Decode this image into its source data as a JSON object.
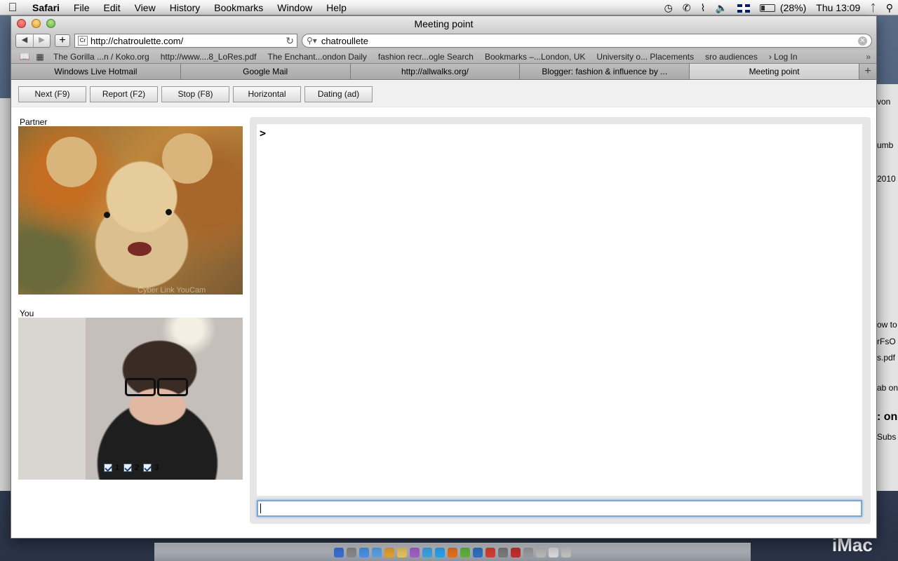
{
  "menubar": {
    "apple": "",
    "items": [
      "Safari",
      "File",
      "Edit",
      "View",
      "History",
      "Bookmarks",
      "Window",
      "Help"
    ],
    "battery": "(28%)",
    "clock": "Thu 13:09"
  },
  "window": {
    "title": "Meeting point"
  },
  "toolbar": {
    "url": "http://chatroulette.com/",
    "favicon_text": "Cr",
    "search_value": "chatroullete"
  },
  "bookmarks": [
    "The Gorilla ...n / Koko.org",
    "http://www....8_LoRes.pdf",
    "The Enchant...ondon Daily",
    "fashion recr...ogle Search",
    "Bookmarks –...London, UK",
    "University o... Placements",
    "sro audiences",
    "› Log In"
  ],
  "tabs": [
    {
      "label": "Windows Live Hotmail",
      "active": false
    },
    {
      "label": "Google Mail",
      "active": false
    },
    {
      "label": "http://allwalks.org/",
      "active": false
    },
    {
      "label": "Blogger: fashion & influence by ...",
      "active": false
    },
    {
      "label": "Meeting point",
      "active": true
    }
  ],
  "controls": {
    "next": "Next (F9)",
    "report": "Report (F2)",
    "stop": "Stop (F8)",
    "horizontal": "Horizontal",
    "dating": "Dating (ad)"
  },
  "videos": {
    "partner_label": "Partner",
    "you_label": "You",
    "watermark": "Cyber Link YouCam"
  },
  "checkboxes": [
    {
      "label": "1",
      "checked": true
    },
    {
      "label": "2",
      "checked": true
    },
    {
      "label": "3",
      "checked": true
    }
  ],
  "chat": {
    "prompt": ">",
    "input_value": ""
  },
  "desktop": {
    "imac_text": "iMac",
    "right_fragments": [
      "von",
      "umb",
      "2010",
      "ow to",
      "rFsO",
      "s.pdf",
      "ab on",
      ": on",
      "Subs"
    ]
  },
  "colors": {
    "focus_ring": "#7aa6d8",
    "chat_frame": "#e6e6e6"
  }
}
